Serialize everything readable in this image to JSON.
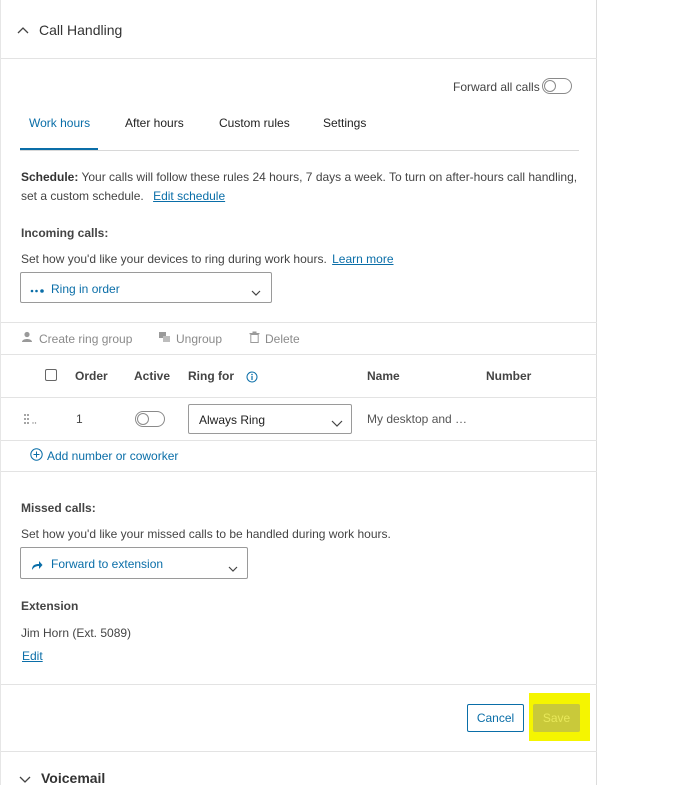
{
  "section_call_handling": {
    "title": "Call Handling"
  },
  "forward_all": {
    "label": "Forward all calls"
  },
  "tabs": [
    {
      "label": "Work hours"
    },
    {
      "label": "After hours"
    },
    {
      "label": "Custom rules"
    },
    {
      "label": "Settings"
    }
  ],
  "schedule": {
    "label": "Schedule:",
    "text_line1": " Your calls will follow these rules 24 hours, 7 days a week. To turn on after-hours call handling,",
    "text_line2": "set a custom schedule.",
    "edit_link": "Edit schedule"
  },
  "incoming": {
    "heading": "Incoming calls:",
    "desc": "Set how you'd like your devices to ring during work hours.",
    "learn_more": "Learn more",
    "mode": "Ring in order"
  },
  "toolbar": {
    "create_ring_group": "Create ring group",
    "ungroup": "Ungroup",
    "delete": "Delete"
  },
  "table": {
    "headers": {
      "order": "Order",
      "active": "Active",
      "ring_for": "Ring for",
      "name": "Name",
      "number": "Number"
    },
    "rows": [
      {
        "order": "1",
        "ring_for": "Always Ring",
        "name": "My desktop and …",
        "number": ""
      }
    ],
    "add_link": "Add number or coworker"
  },
  "missed": {
    "heading": "Missed calls:",
    "desc": "Set how you'd like your missed calls to be handled during work hours.",
    "mode": "Forward to extension",
    "extension_label": "Extension",
    "extension_value": "Jim Horn (Ext. 5089)",
    "edit_link": "Edit"
  },
  "footer": {
    "cancel": "Cancel",
    "save": "Save"
  },
  "section_voicemail": {
    "title": "Voicemail"
  },
  "colors": {
    "accent": "#0a6ea8",
    "highlight": "#f5f500",
    "save_bg": "#c9c93a"
  }
}
